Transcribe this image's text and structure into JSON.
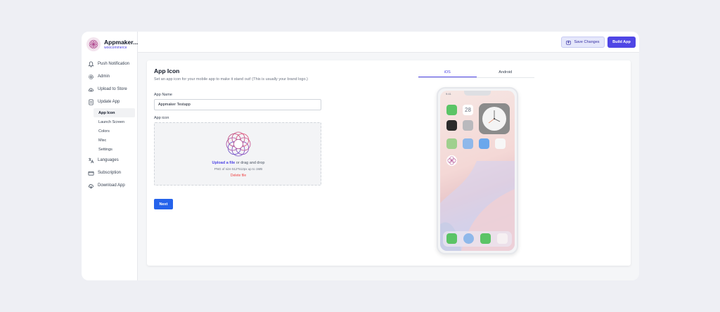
{
  "brand": {
    "name": "Appmaker...",
    "platform": "woocommerce",
    "accent": "#4f46e5"
  },
  "sidebar": {
    "items": [
      {
        "label": "Push Notification",
        "icon": "bell-icon"
      },
      {
        "label": "Admin",
        "icon": "gear-icon"
      },
      {
        "label": "Upload to Store",
        "icon": "cloud-upload-icon"
      },
      {
        "label": "Update App",
        "icon": "document-icon"
      },
      {
        "label": "Languages",
        "icon": "translate-icon"
      },
      {
        "label": "Subscription",
        "icon": "credit-card-icon"
      },
      {
        "label": "Download App",
        "icon": "cloud-download-icon"
      }
    ],
    "subitems": [
      "App Icon",
      "Launch Screen",
      "Colors",
      "Misc",
      "Settings"
    ],
    "active_subitem": "App Icon"
  },
  "topbar": {
    "save_label": "Save Changes",
    "build_label": "Build App"
  },
  "main": {
    "title": "App Icon",
    "description": "Set an app icon for your mobile app to make it stand out! (This is usually your brand logo.)",
    "app_name_label": "App Name",
    "app_name_value": "Appmaker Testapp",
    "app_icon_label": "App icon",
    "upload": {
      "link": "Upload a file",
      "rest": " or drag and drop",
      "hint": "PNG of size 512*512px up to 1MB",
      "delete": "Delete file"
    },
    "next_label": "Next"
  },
  "preview": {
    "tabs": [
      "iOS",
      "Android"
    ],
    "active_tab": "iOS",
    "status_time": "9:41",
    "calendar_day": "28"
  }
}
